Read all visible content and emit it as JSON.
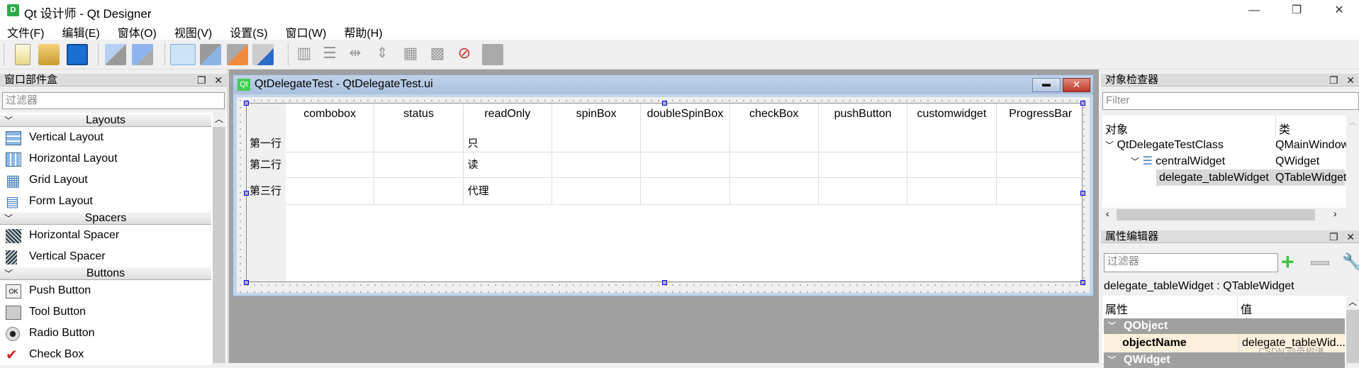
{
  "window": {
    "title": "Qt 设计师 - Qt Designer",
    "app_icon": "D",
    "controls": [
      "minimize",
      "maximize",
      "close"
    ]
  },
  "menu": [
    "文件(F)",
    "编辑(E)",
    "窗体(O)",
    "视图(V)",
    "设置(S)",
    "窗口(W)",
    "帮助(H)"
  ],
  "toolbar": {
    "icons": [
      "new-file",
      "open-folder",
      "save",
      "send-to-back",
      "bring-to-front",
      "edit-widgets",
      "edit-signals-slots",
      "edit-buddies",
      "edit-tab-order",
      "layout-horizontal",
      "layout-vertical",
      "layout-horizontal-splitter",
      "layout-vertical-splitter",
      "layout-grid",
      "layout-form",
      "break-layout",
      "adjust-size"
    ]
  },
  "widget_box": {
    "title": "窗口部件盒",
    "filter_placeholder": "过滤器",
    "categories": [
      {
        "name": "Layouts",
        "items": [
          "Vertical Layout",
          "Horizontal Layout",
          "Grid Layout",
          "Form Layout"
        ]
      },
      {
        "name": "Spacers",
        "items": [
          "Horizontal Spacer",
          "Vertical Spacer"
        ]
      },
      {
        "name": "Buttons",
        "items": [
          "Push Button",
          "Tool Button",
          "Radio Button",
          "Check Box"
        ]
      }
    ]
  },
  "form_window": {
    "title": "QtDelegateTest - QtDelegateTest.ui",
    "icon": "Qt",
    "table": {
      "columns": [
        "combobox",
        "status",
        "readOnly",
        "spinBox",
        "doubleSpinBox",
        "checkBox",
        "pushButton",
        "customwidget",
        "ProgressBar"
      ],
      "rows": [
        {
          "header": "第一行",
          "readOnly": "只"
        },
        {
          "header": "第二行",
          "readOnly": "读"
        },
        {
          "header": "第三行",
          "readOnly": "代理"
        }
      ]
    }
  },
  "object_inspector": {
    "title": "对象检查器",
    "filter_placeholder": "Filter",
    "col_object": "对象",
    "col_class": "类",
    "rows": [
      {
        "name": "QtDelegateTestClass",
        "class": "QMainWindow"
      },
      {
        "name": "centralWidget",
        "class": "QWidget"
      },
      {
        "name": "delegate_tableWidget",
        "class": "QTableWidget"
      }
    ]
  },
  "property_editor": {
    "title": "属性编辑器",
    "filter_placeholder": "过滤器",
    "object_label": "delegate_tableWidget : QTableWidget",
    "col_property": "属性",
    "col_value": "值",
    "sections": [
      {
        "name": "QObject"
      },
      {
        "name": "QWidget"
      }
    ],
    "object_name_label": "objectName",
    "object_name_value": "delegate_tableWid..."
  },
  "watermark": "CSDN @奇树谦"
}
